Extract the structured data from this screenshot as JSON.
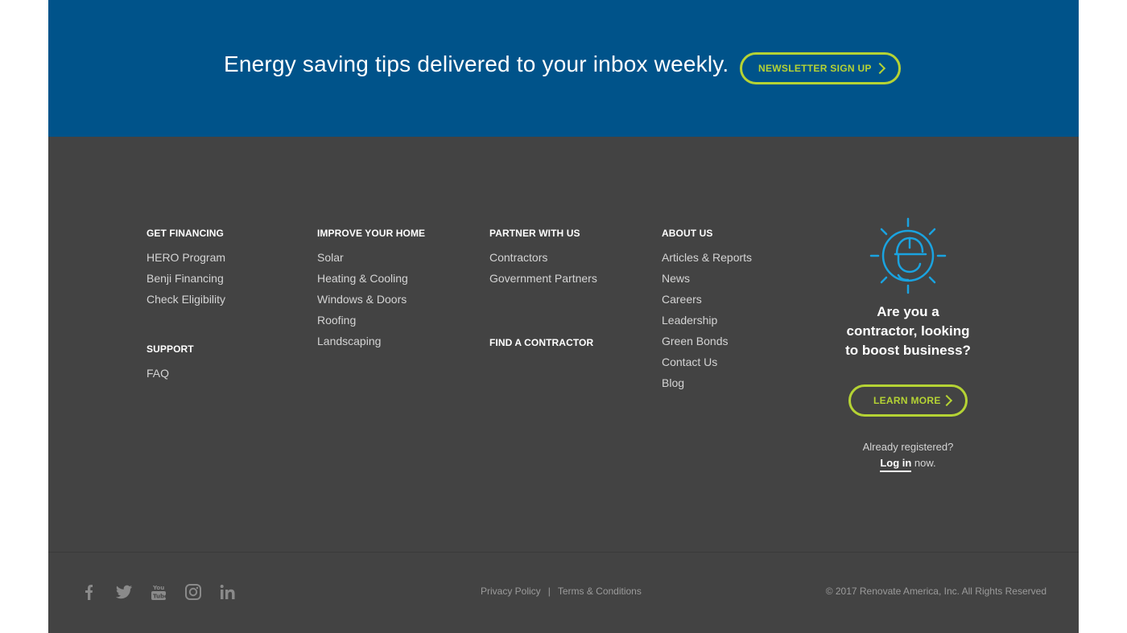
{
  "newsletter": {
    "tagline": "Energy saving tips delivered to your inbox weekly.",
    "button_label": "NEWSLETTER SIGN UP"
  },
  "footer": {
    "columns": [
      {
        "heading": "GET FINANCING",
        "links": [
          "HERO Program",
          "Benji Financing",
          "Check Eligibility"
        ],
        "section2_heading": "SUPPORT",
        "section2_links": [
          "FAQ"
        ]
      },
      {
        "heading": "IMPROVE YOUR HOME",
        "links": [
          "Solar",
          "Heating & Cooling",
          "Windows & Doors",
          "Roofing",
          "Landscaping"
        ]
      },
      {
        "heading": "PARTNER WITH US",
        "links": [
          "Contractors",
          "Government Partners"
        ],
        "section2_heading": "FIND A CONTRACTOR"
      },
      {
        "heading": "ABOUT US",
        "links": [
          "Articles & Reports",
          "News",
          "Careers",
          "Leadership",
          "Green Bonds",
          "Contact Us",
          "Blog"
        ]
      }
    ],
    "contractor": {
      "icon": "contractor-helmet-icon",
      "pitch_line1": "Are you a",
      "pitch_line2": "contractor, looking",
      "pitch_line3": "to boost business?",
      "button_label": "LEARN MORE",
      "already": "Already registered?",
      "login_label": "Log in",
      "login_suffix": " now."
    }
  },
  "bottom": {
    "social": [
      "facebook-icon",
      "twitter-icon",
      "youtube-icon",
      "instagram-icon",
      "linkedin-icon"
    ],
    "privacy": "Privacy Policy",
    "separator": "|",
    "terms": "Terms & Conditions",
    "copyright": "© 2017 Renovate America, Inc. All Rights Reserved"
  },
  "colors": {
    "newsletter_bg": "#00538a",
    "footer_bg": "#434343",
    "accent_green": "#b5d334",
    "icon_blue": "#1aa3e0"
  }
}
